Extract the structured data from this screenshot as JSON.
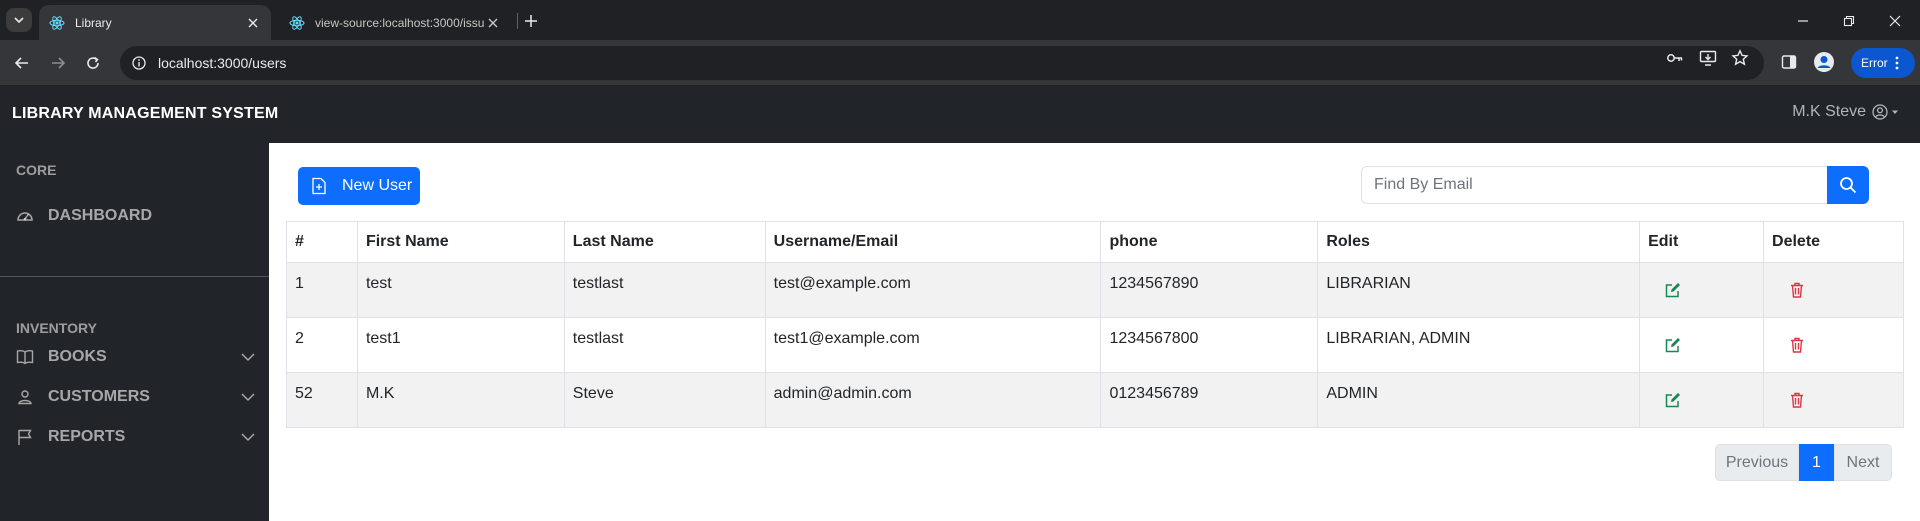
{
  "browser": {
    "tabs": [
      {
        "title": "Library",
        "active": true
      },
      {
        "title": "view-source:localhost:3000/issu",
        "active": false
      }
    ],
    "url": "localhost:3000/users",
    "error_label": "Error"
  },
  "app": {
    "brand": "LIBRARY MANAGEMENT SYSTEM",
    "user_name": "M.K Steve"
  },
  "sidebar": {
    "core_heading": "CORE",
    "dashboard_label": "DASHBOARD",
    "inventory_heading": "INVENTORY",
    "items": [
      {
        "label": "BOOKS",
        "icon": "book-icon"
      },
      {
        "label": "CUSTOMERS",
        "icon": "person-icon"
      },
      {
        "label": "REPORTS",
        "icon": "flag-icon"
      }
    ]
  },
  "main": {
    "new_user_label": "New User",
    "search_placeholder": "Find By Email",
    "table": {
      "headers": [
        "#",
        "First Name",
        "Last Name",
        "Username/Email",
        "phone",
        "Roles",
        "Edit",
        "Delete"
      ],
      "rows": [
        {
          "id": "1",
          "first": "test",
          "last": "testlast",
          "email": "test@example.com",
          "phone": "1234567890",
          "roles": "LIBRARIAN"
        },
        {
          "id": "2",
          "first": "test1",
          "last": "testlast",
          "email": "test1@example.com",
          "phone": "1234567800",
          "roles": "LIBRARIAN, ADMIN"
        },
        {
          "id": "52",
          "first": "M.K",
          "last": "Steve",
          "email": "admin@admin.com",
          "phone": "0123456789",
          "roles": "ADMIN"
        }
      ]
    },
    "pagination": {
      "previous": "Previous",
      "current": "1",
      "next": "Next"
    }
  },
  "colors": {
    "primary": "#0d6efd",
    "dark": "#212529",
    "edit": "#198754",
    "delete": "#dc3545"
  }
}
